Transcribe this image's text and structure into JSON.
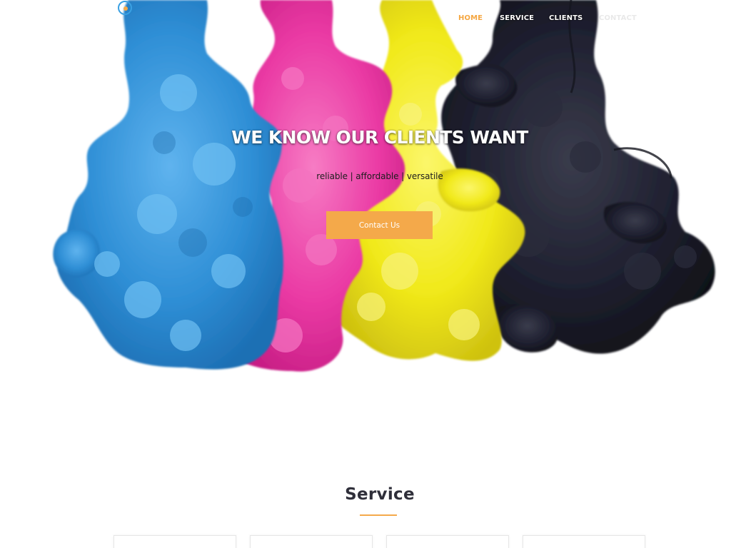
{
  "nav": {
    "items": [
      {
        "label": "HOME",
        "active": true
      },
      {
        "label": "SERVICE",
        "active": false
      },
      {
        "label": "CLIENTS",
        "active": false
      },
      {
        "label": "CONTACT",
        "active": false
      }
    ]
  },
  "hero": {
    "headline": "WE KNOW OUR CLIENTS WANT",
    "tagline": "reliable | affordable | versatile",
    "cta_label": "Contact Us"
  },
  "service": {
    "title": "Service",
    "card_count": 4
  },
  "colors": {
    "accent": "#f4a94a",
    "ink_cyan": "#2f8fd6",
    "ink_magenta": "#ea3aa4",
    "ink_yellow": "#f3ec1c",
    "ink_black": "#1c1d29",
    "title_text": "#2f2f3a"
  },
  "icons": {
    "logo": "brand-logo-icon"
  }
}
